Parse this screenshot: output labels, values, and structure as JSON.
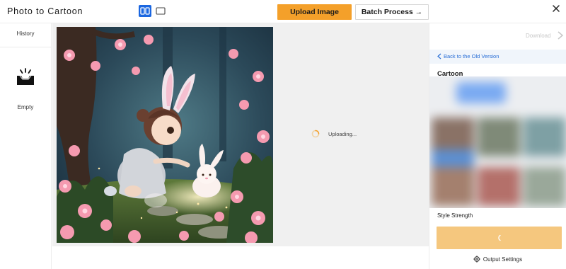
{
  "header": {
    "app_title": "Photo to Cartoon",
    "view_toggle_active": "split-view",
    "upload_label": "Upload Image",
    "batch_label": "Batch Process →"
  },
  "sidebar": {
    "history_label": "History",
    "empty_label": "Empty"
  },
  "canvas": {
    "uploading_text": "Uploading..."
  },
  "right_panel": {
    "download_label": "Download",
    "back_label": "Back to the Old Version",
    "style_title": "Cartoon",
    "strength_label": "Style Strength",
    "output_settings_label": "Output Settings"
  },
  "colors": {
    "accent_orange": "#f4a02a",
    "toggle_blue": "#1a66e0",
    "link_blue": "#2a6fd6",
    "generate_disabled": "#f5c77e"
  }
}
